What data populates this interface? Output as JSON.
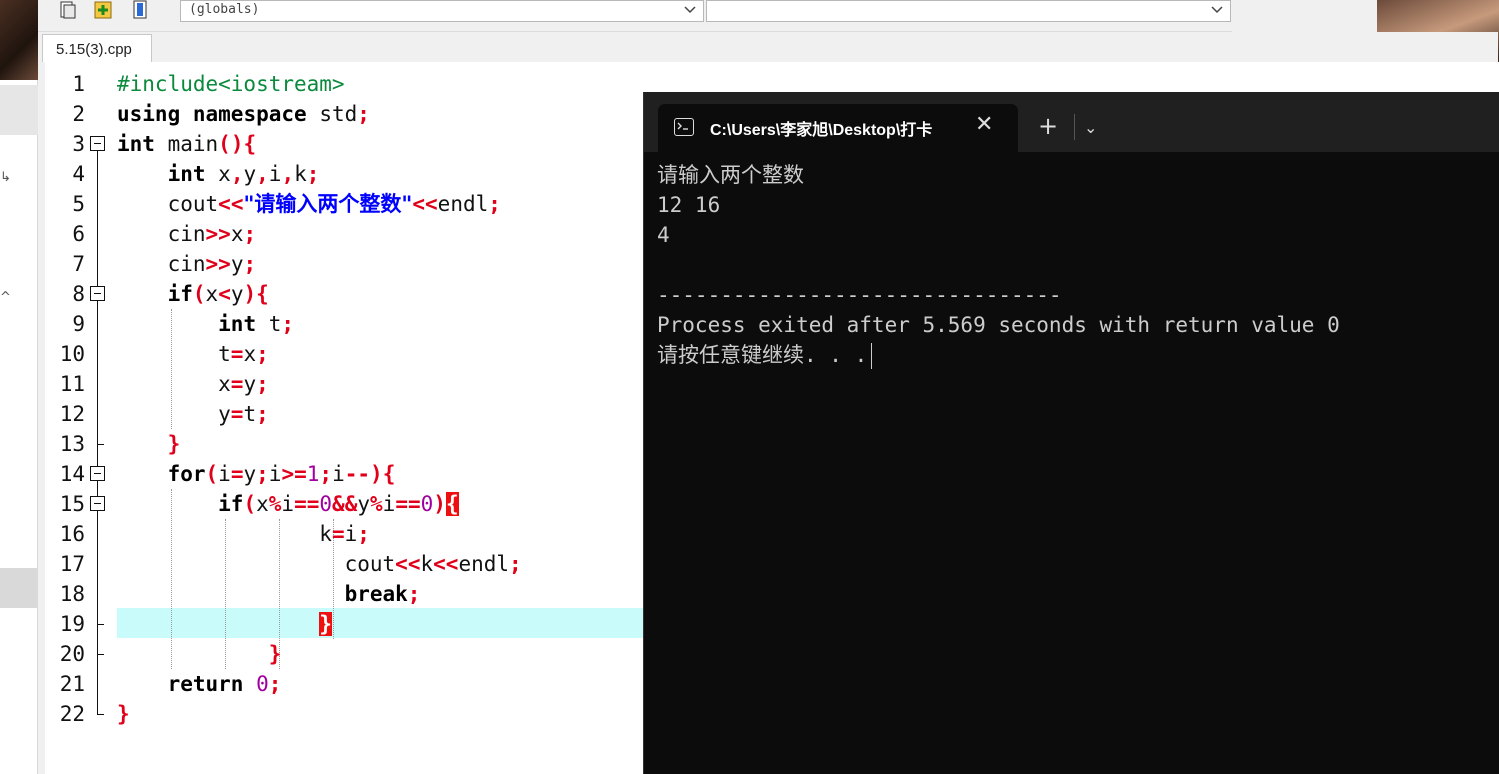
{
  "ide": {
    "toolbar": {
      "scope_combo_value": "(globals)",
      "member_combo_value": ""
    },
    "file_tab": "5.15(3).cpp",
    "line_numbers": [
      "1",
      "2",
      "3",
      "4",
      "5",
      "6",
      "7",
      "8",
      "9",
      "10",
      "11",
      "12",
      "13",
      "14",
      "15",
      "16",
      "17",
      "18",
      "19",
      "20",
      "21",
      "22"
    ],
    "code_lines": [
      "#include<iostream>",
      "using namespace std;",
      "int main(){",
      "    int x,y,i,k;",
      "    cout<<\"请输入两个整数\"<<endl;",
      "    cin>>x;",
      "    cin>>y;",
      "    if(x<y){",
      "        int t;",
      "        t=x;",
      "        x=y;",
      "        y=t;",
      "    }",
      "    for(i=y;i>=1;i--){",
      "        if(x%i==0&&y%i==0){",
      "                k=i;",
      "                  cout<<k<<endl;",
      "                  break;",
      "                }",
      "            }",
      "    return 0;",
      "}"
    ],
    "current_line": "19"
  },
  "terminal": {
    "tab_title": "C:\\Users\\李家旭\\Desktop\\打卡",
    "tab_close": "✕",
    "new_tab": "+",
    "dropdown": "⌄",
    "output_lines": [
      "请输入两个整数",
      "12 16",
      "4",
      "",
      "--------------------------------",
      "Process exited after 5.569 seconds with return value 0",
      "请按任意键继续. . ."
    ]
  },
  "icons": [
    "project-icon",
    "add-icon",
    "bookmark-icon",
    "chevron-down-icon",
    "terminal-icon",
    "close-icon",
    "plus-icon"
  ],
  "colors": {
    "keyword": "#000000",
    "preprocessor": "#0a8a3c",
    "punctuation": "#e0001a",
    "number": "#a000a0",
    "string": "#0000ff",
    "current_line_bg": "#c9fbfb",
    "bracket_match": "#ee1010",
    "terminal_bg": "#0c0c0c",
    "terminal_text": "#cccccc"
  }
}
